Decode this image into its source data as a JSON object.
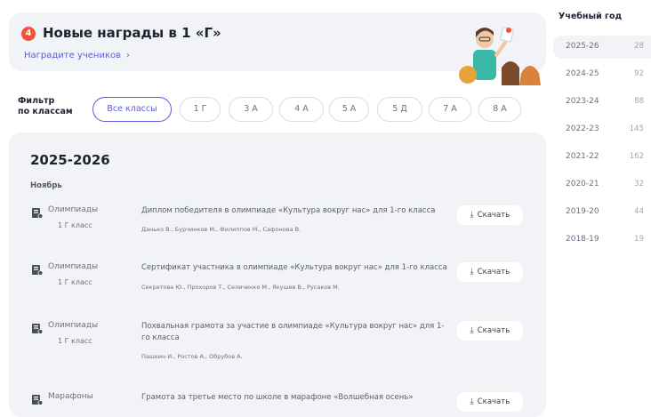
{
  "banner": {
    "badge": "4",
    "title": "Новые награды в 1 «Г»",
    "link": "Наградите учеников",
    "link_chevron": "›"
  },
  "filter": {
    "label_line1": "Фильтр",
    "label_line2": "по классам",
    "classes": [
      "Все классы",
      "1 Г",
      "3 А",
      "4 А",
      "5 А",
      "5 Д",
      "7 А",
      "8 А"
    ],
    "active_index": 0
  },
  "main": {
    "year": "2025-2026",
    "month": "Ноябрь",
    "download_label": "Скачать",
    "download_icon": "download-icon",
    "awards": [
      {
        "category": "Олимпиады",
        "class": "1 Г класс",
        "title": "Диплом победителя в олимпиаде «Культура вокруг нас» для 1-го класса",
        "names": "Данько В., Бурчинков М., Филиппов М., Сафонова В."
      },
      {
        "category": "Олимпиады",
        "class": "1 Г класс",
        "title": "Сертификат участника в олимпиаде «Культура вокруг нас» для 1-го класса",
        "names": "Секретова Ю., Прохоров Т., Селиченко М., Якушев В., Русаков М."
      },
      {
        "category": "Олимпиады",
        "class": "1 Г класс",
        "title": "Похвальная грамота за участие в олимпиаде «Культура вокруг нас» для 1-го класса",
        "names": "Пашкин И., Ростов А., Обрубов А."
      },
      {
        "category": "Марафоны",
        "class": "",
        "title": "Грамота за третье место по школе в марафоне «Волшебная осень»",
        "names": ""
      }
    ]
  },
  "sidebar": {
    "title": "Учебный год",
    "years": [
      {
        "label": "2025-26",
        "count": "28"
      },
      {
        "label": "2024-25",
        "count": "92"
      },
      {
        "label": "2023-24",
        "count": "88"
      },
      {
        "label": "2022-23",
        "count": "145"
      },
      {
        "label": "2021-22",
        "count": "162"
      },
      {
        "label": "2020-21",
        "count": "32"
      },
      {
        "label": "2019-20",
        "count": "44"
      },
      {
        "label": "2018-19",
        "count": "19"
      }
    ],
    "active_index": 0
  },
  "colors": {
    "accent": "#5a5cd6",
    "badge": "#f2523a",
    "card_bg": "#f1f3f7"
  }
}
